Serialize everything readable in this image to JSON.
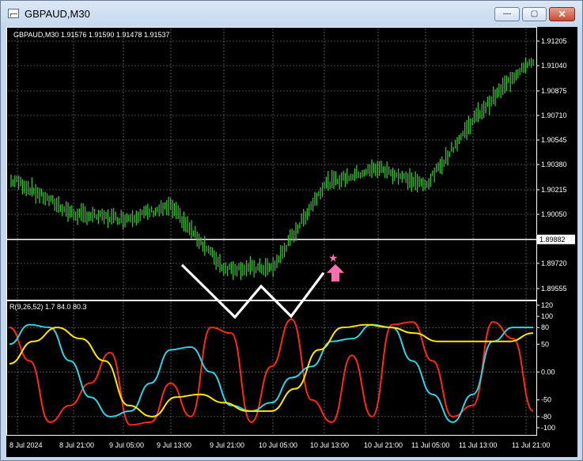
{
  "window": {
    "title": "GBPAUD,M30",
    "min_glyph": "—",
    "max_glyph": "▢",
    "close_glyph": "✕"
  },
  "chart": {
    "header": "GBPAUD,M30  1.91576 1.91590 1.91478 1.91537",
    "price_ticks": [
      "1.91205",
      "1.91040",
      "1.90875",
      "1.90710",
      "1.90545",
      "1.90380",
      "1.90215",
      "1.90050",
      "1.89720",
      "1.89555"
    ],
    "current_price": "1.89882",
    "indicator_header": "R(9,26,52) 1.7 84.0 80.3",
    "indicator_ticks": [
      "120",
      "100",
      "80",
      "50",
      "0.00",
      "-50",
      "-80",
      "-100"
    ],
    "time_ticks": [
      "8 Jul 2024",
      "8 Jul 21:00",
      "9 Jul 05:00",
      "9 Jul 13:00",
      "9 Jul 21:00",
      "10 Jul 05:00",
      "10 Jul 13:00",
      "10 Jul 21:00",
      "11 Jul 05:00",
      "11 Jul 13:00",
      "11 Jul 21:00"
    ],
    "colors": {
      "candles": "#34c22f",
      "grid": "#ffffff",
      "price_line": "#ffffff",
      "marker": "#ff6fae",
      "line_fast": "#ff2a12",
      "line_mid": "#30d3e6",
      "line_slow": "#ffe800"
    },
    "icons": {
      "marker_star": "star-icon",
      "marker_arrow": "arrow-up-icon"
    }
  },
  "chart_data": {
    "type": "line",
    "price_axis": {
      "ylim": [
        1.8949,
        1.9128
      ]
    },
    "price_series": [
      {
        "x": "8 Jul 2024",
        "y": 1.9027
      },
      {
        "x": "8 Jul 21:00",
        "y": 1.9005
      },
      {
        "x": "9 Jul 05:00",
        "y": 1.9002
      },
      {
        "x": "9 Jul 13:00",
        "y": 1.901
      },
      {
        "x": "9 Jul 21:00",
        "y": 1.8969
      },
      {
        "x": "10 Jul 05:00",
        "y": 1.8969
      },
      {
        "x": "10 Jul 13:00",
        "y": 1.9025
      },
      {
        "x": "10 Jul 21:00",
        "y": 1.9036
      },
      {
        "x": "11 Jul 05:00",
        "y": 1.9024
      },
      {
        "x": "11 Jul 13:00",
        "y": 1.9068
      },
      {
        "x": "11 Jul 21:00",
        "y": 1.9106
      }
    ],
    "indicator_axis": {
      "ylim": [
        -110,
        120
      ]
    },
    "indicator_series": [
      {
        "values": [
          80,
          20,
          -90,
          -60,
          -20,
          35,
          -95,
          -90,
          -20,
          -80,
          80,
          70,
          -90,
          10,
          95,
          -50,
          -90,
          30,
          -80,
          85,
          90,
          20,
          -80,
          -60,
          90,
          60,
          -70
        ]
      },
      {
        "values": [
          50,
          85,
          80,
          20,
          -45,
          -80,
          -70,
          -20,
          40,
          45,
          0,
          -60,
          -70,
          -55,
          -10,
          10,
          55,
          60,
          85,
          80,
          20,
          -40,
          -90,
          -40,
          55,
          80,
          80
        ]
      },
      {
        "values": [
          15,
          55,
          80,
          60,
          20,
          -60,
          -80,
          -45,
          -40,
          -55,
          -70,
          -70,
          -30,
          40,
          80,
          85,
          80,
          70,
          55,
          55,
          55,
          55,
          70
        ]
      }
    ]
  }
}
